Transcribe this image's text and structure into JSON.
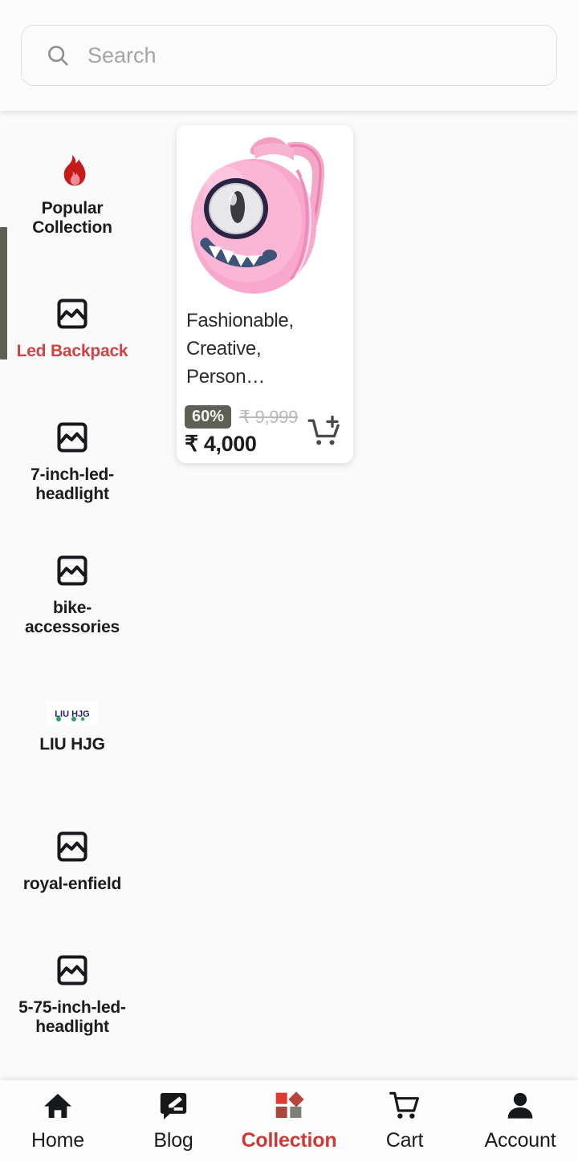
{
  "search": {
    "placeholder": "Search",
    "value": "",
    "icon": "search-icon"
  },
  "sidebar": {
    "items": [
      {
        "label": "Popular Collection",
        "icon": "fire-icon",
        "active": false
      },
      {
        "label": "Led Backpack",
        "icon": "image-broken-icon",
        "active": true
      },
      {
        "label": "7-inch-led-headlight",
        "icon": "image-broken-icon",
        "active": false
      },
      {
        "label": "bike-accessories",
        "icon": "image-broken-icon",
        "active": false
      },
      {
        "label": "LIU HJG",
        "icon": "brand-thumbnail",
        "thumb_text": "LIU HJG",
        "active": false
      },
      {
        "label": "royal-enfield",
        "icon": "image-broken-icon",
        "active": false
      },
      {
        "label": "5-75-inch-led-headlight",
        "icon": "image-broken-icon",
        "active": false
      }
    ]
  },
  "products": [
    {
      "title": "Fashionable, Creative, Person…",
      "discount": "60%",
      "mrp": "₹ 9,999",
      "price": "₹ 4,000",
      "image_alt": "pink monster one-eye backpack",
      "cart_icon": "add-to-cart-icon"
    }
  ],
  "bottom_nav": {
    "items": [
      {
        "label": "Home",
        "icon": "home-icon",
        "active": false
      },
      {
        "label": "Blog",
        "icon": "blog-icon",
        "active": false
      },
      {
        "label": "Collection",
        "icon": "collection-icon",
        "active": true
      },
      {
        "label": "Cart",
        "icon": "cart-icon",
        "active": false
      },
      {
        "label": "Account",
        "icon": "account-icon",
        "active": false
      }
    ]
  },
  "colors": {
    "accent_red": "#cc3a33",
    "active_label_red": "#cc4444",
    "badge_olive": "#5d6055",
    "scroll_indicator": "#5d6055",
    "background": "#fafafa",
    "card": "#ffffff",
    "text": "#1c1c1c",
    "muted": "#b9b9b9"
  }
}
